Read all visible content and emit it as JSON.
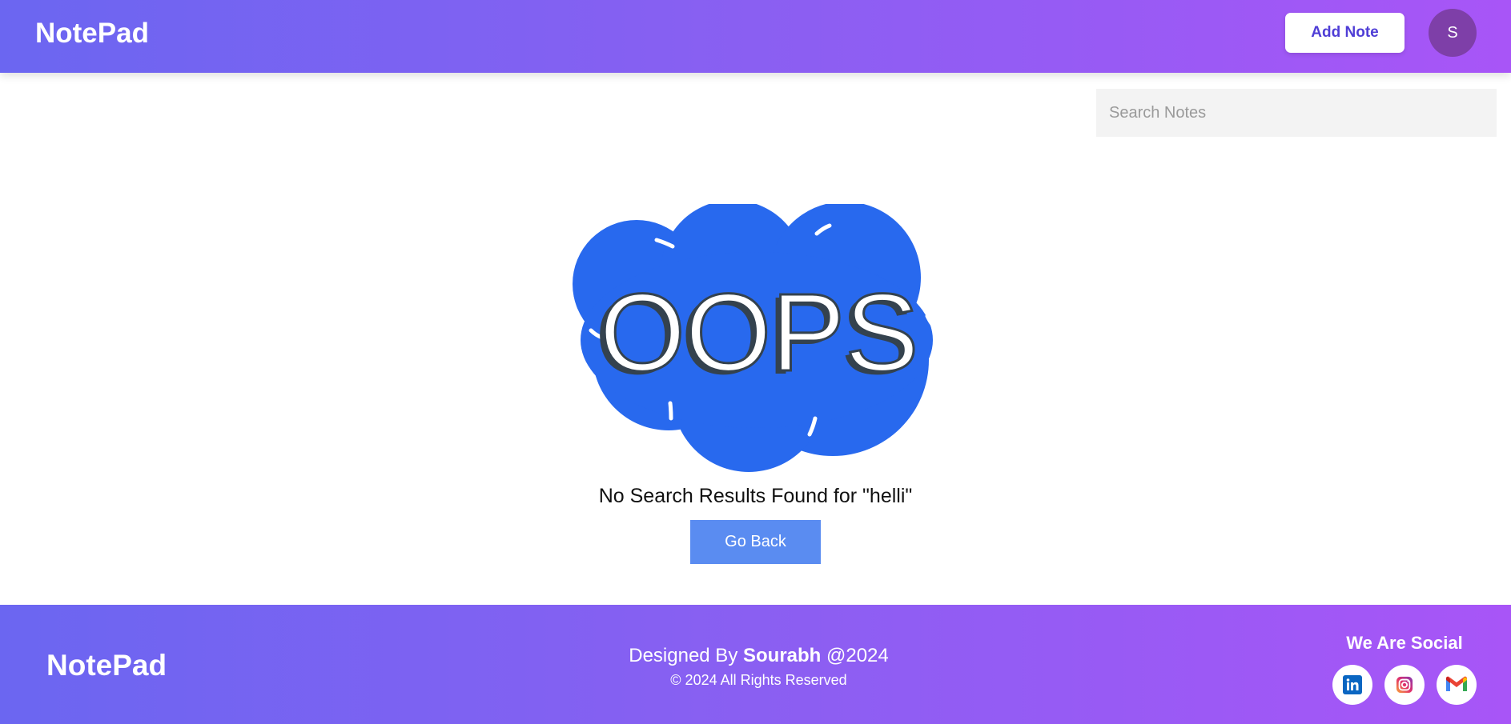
{
  "header": {
    "brand": "NotePad",
    "add_note_label": "Add Note",
    "avatar_initial": "S"
  },
  "search": {
    "placeholder": "Search Notes",
    "value": ""
  },
  "main": {
    "illustration_text": "OOPS",
    "message": "No Search Results Found for \"helli\"",
    "go_back_label": "Go Back"
  },
  "footer": {
    "brand": "NotePad",
    "designed_by_prefix": "Designed By",
    "designer_name": "Sourabh",
    "year_suffix": "@2024",
    "copyright": "© 2024 All Rights Reserved",
    "social_title": "We Are Social",
    "social_icons": [
      "linkedin-icon",
      "instagram-icon",
      "gmail-icon"
    ]
  },
  "colors": {
    "gradient_start": "#6b66f1",
    "gradient_end": "#a855f7",
    "accent_button": "#5a8cf1",
    "oops_blue": "#2869ee",
    "avatar_bg": "#7e3fa8"
  }
}
